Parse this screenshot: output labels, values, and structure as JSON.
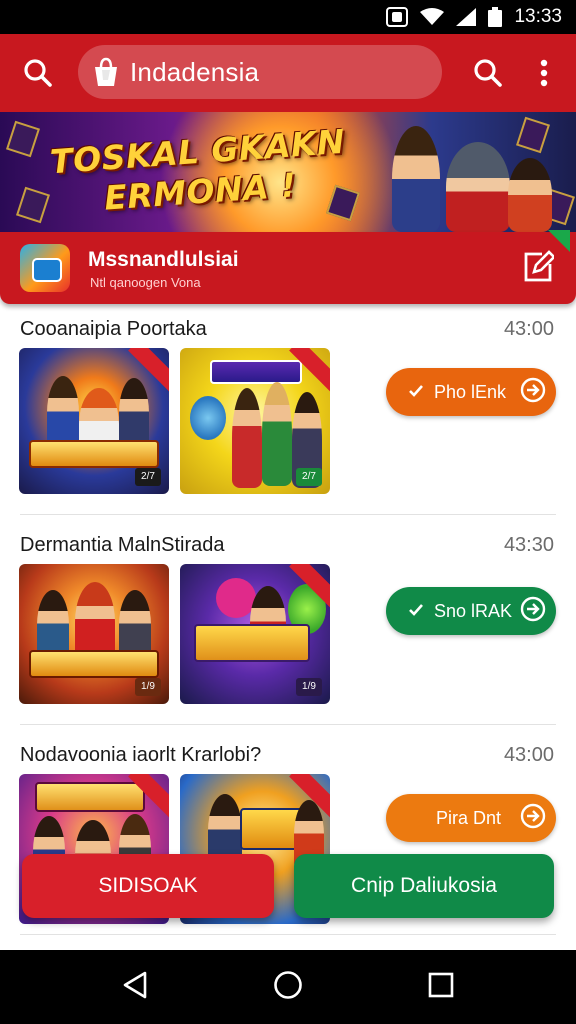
{
  "status_bar": {
    "time": "13:33"
  },
  "app_bar": {
    "title": "Indadensia"
  },
  "banner": {
    "headline_line1": "TOSKAL GKAKN",
    "headline_line2": "ERMONA !"
  },
  "featured": {
    "name": "Mssnandlulsiai",
    "subtitle": "Ntl qanoogen Vona"
  },
  "sections": [
    {
      "title": "Cooanaipia Poortaka",
      "time": "43:00",
      "thumbnails": [
        {
          "logo": "RAHBAMAI",
          "tag": "2/7"
        },
        {
          "logo": "WIOISOAK",
          "tag": "2/7"
        }
      ],
      "button": {
        "label": "Pho lEnk",
        "color": "#e8650e"
      }
    },
    {
      "title": "Dermantia MalnStirada",
      "time": "43:30",
      "thumbnails": [
        {
          "logo": "FURAHIEEB",
          "tag": "1/9"
        },
        {
          "logo": "BUNHAIG",
          "tag": "1/9"
        }
      ],
      "button": {
        "label": "Sno lRAK",
        "color": "#108a48"
      }
    },
    {
      "title": "Nodavoonia iaorlt Krarlobi?",
      "time": "43:00",
      "thumbnails": [
        {
          "logo": "KOSIRAIL",
          "tag": ""
        },
        {
          "logo": "PUHI",
          "tag": ""
        }
      ],
      "button": {
        "label": "Pira Dnt",
        "color": "#ec7a10"
      }
    }
  ],
  "bottom_buttons": {
    "left_label": "SIDISOAK",
    "right_label": "Cnip Daliukosia",
    "left_color": "#d8202a",
    "right_color": "#108a48"
  },
  "icons": {
    "search_left": "search-icon",
    "search_right": "search-icon",
    "menu": "more-vert-icon",
    "app_logo": "shopping-bag-icon",
    "edit": "edit-icon",
    "check": "check-icon",
    "arrow_circle": "arrow-circle-icon",
    "nav_back": "back-triangle-icon",
    "nav_home": "home-circle-icon",
    "nav_recents": "recents-square-icon"
  },
  "colors": {
    "accent": "#c8181f"
  }
}
